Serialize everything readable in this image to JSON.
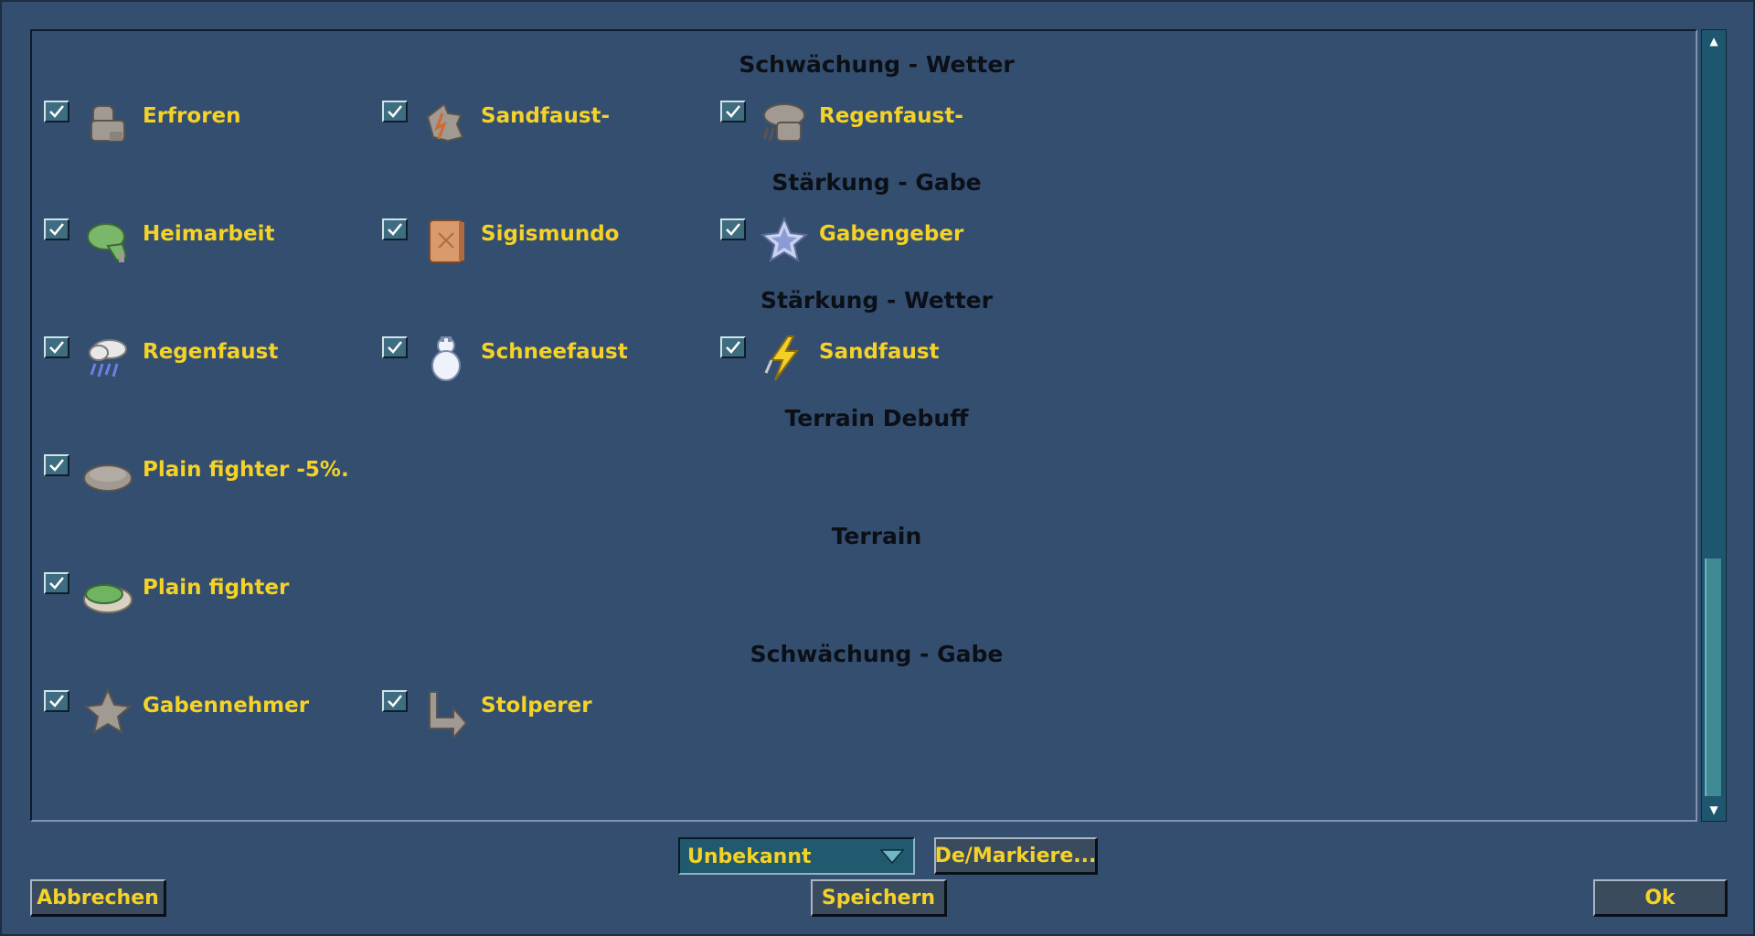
{
  "sections": [
    {
      "title": "Schwächung - Wetter",
      "items": [
        {
          "label": "Erfroren",
          "icon": "frozen-figure-icon"
        },
        {
          "label": "Sandfaust-",
          "icon": "sandfist-debuff-icon"
        },
        {
          "label": "Regenfaust-",
          "icon": "rainfist-debuff-icon"
        }
      ]
    },
    {
      "title": "Stärkung - Gabe",
      "items": [
        {
          "label": "Heimarbeit",
          "icon": "green-turtle-icon"
        },
        {
          "label": "Sigismundo",
          "icon": "scroll-tablet-icon"
        },
        {
          "label": "Gabengeber",
          "icon": "star-icon"
        }
      ]
    },
    {
      "title": "Stärkung - Wetter",
      "items": [
        {
          "label": "Regenfaust",
          "icon": "raincloud-icon"
        },
        {
          "label": "Schneefaust",
          "icon": "snowman-icon"
        },
        {
          "label": "Sandfaust",
          "icon": "lightning-icon"
        }
      ]
    },
    {
      "title": "Terrain Debuff",
      "items": [
        {
          "label": "Plain fighter -5%.",
          "icon": "grey-terrain-icon"
        }
      ]
    },
    {
      "title": "Terrain",
      "items": [
        {
          "label": "Plain fighter",
          "icon": "grass-terrain-icon"
        }
      ]
    },
    {
      "title": "Schwächung - Gabe",
      "items": [
        {
          "label": "Gabennehmer",
          "icon": "grey-star-icon"
        },
        {
          "label": "Stolperer",
          "icon": "turn-arrow-icon"
        }
      ]
    }
  ],
  "filter": {
    "selected": "Unbekannt"
  },
  "buttons": {
    "toggle_mark": "De/Markiere...",
    "cancel": "Abbrechen",
    "save": "Speichern",
    "ok": "Ok"
  },
  "colors": {
    "background": "#344e70",
    "label_yellow": "#f4d228",
    "heading": "#0b0f16",
    "checkbox": "#3e6c80",
    "scrollbar": "#1e5670"
  }
}
